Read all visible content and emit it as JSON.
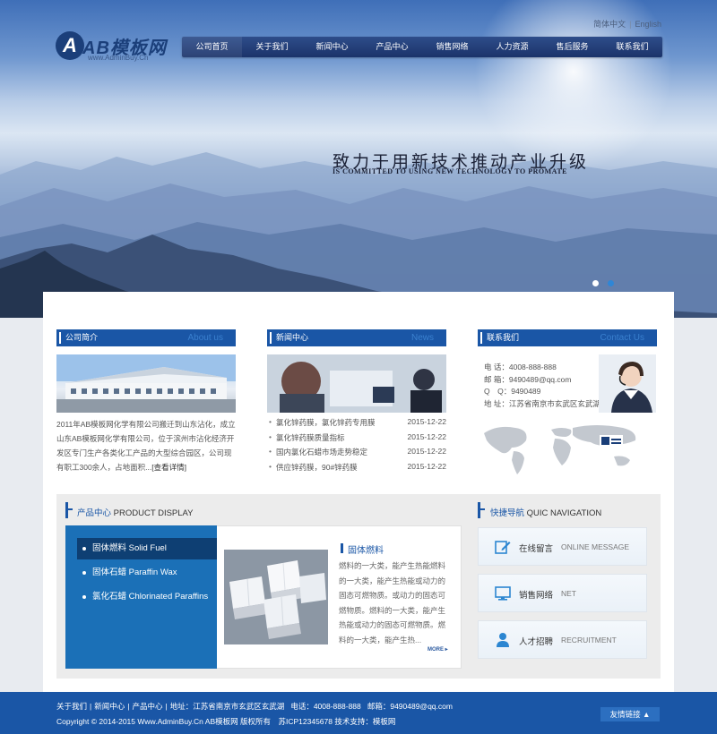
{
  "brand": {
    "logo_text": "AB模板网",
    "logo_mark": "A",
    "logo_sub": "www.AdminBuy.Cn"
  },
  "lang": [
    "简体中文",
    "English"
  ],
  "nav": [
    "公司首页",
    "关于我们",
    "新闻中心",
    "产品中心",
    "销售网络",
    "人力资源",
    "售后服务",
    "联系我们"
  ],
  "hero": {
    "slogan_cn": "致力于用新技术推动产业升级",
    "slogan_en": "IS COMMITTED TO USING NEW TECHNOLOGY TO PROMATE"
  },
  "about": {
    "title": "公司简介",
    "title_en": "About us",
    "text": "2011年AB模板网化学有限公司搬迁到山东沾化，成立山东AB模板网化学有限公司，位于滨州市沾化经济开发区专门生产各类化工产品的大型综合园区，公司现有职工300余人，占地面积...",
    "more": "[查看详情]"
  },
  "news": {
    "title": "新闻中心",
    "title_en": "News",
    "items": [
      {
        "title": "氯化锌药膜，氯化锌药专用膜",
        "date": "2015-12-22"
      },
      {
        "title": "氯化锌药膜质量指标",
        "date": "2015-12-22"
      },
      {
        "title": "国内氯化石蜡市场走势稳定",
        "date": "2015-12-22"
      },
      {
        "title": "供应锌药膜，90#锌药膜",
        "date": "2015-12-22"
      }
    ]
  },
  "contact": {
    "title": "联系我们",
    "title_en": "Contact Us",
    "lines": [
      "电 话：4008-888-888",
      "邮 箱：9490489@qq.com",
      "Q　Q：9490489",
      "地 址：江苏省南京市玄武区玄武湖"
    ]
  },
  "products": {
    "title": "产品中心",
    "title_en": "PRODUCT DISPLAY",
    "menu": [
      "固体燃料 Solid Fuel",
      "固体石蜡 Paraffin Wax",
      "氯化石蜡 Chlorinated Paraffins"
    ],
    "active_index": 0,
    "feature_title": "固体燃料",
    "feature_desc": "燃料的一大类，能产生热能燃料的一大类，能产生热能或动力的固态可燃物质。或动力的固态可燃物质。燃料的一大类，能产生热能或动力的固态可燃物质。燃料的一大类，能产生热...",
    "more": "MORE"
  },
  "quick_nav": {
    "title": "快捷导航",
    "title_en": "QUIC NAVIGATION",
    "items": [
      {
        "cn": "在线留言",
        "en": "ONLINE MESSAGE",
        "icon": "edit-icon"
      },
      {
        "cn": "销售网络",
        "en": "NET",
        "icon": "monitor-icon"
      },
      {
        "cn": "人才招聘",
        "en": "RECRUITMENT",
        "icon": "person-icon"
      }
    ]
  },
  "footer": {
    "links": [
      "关于我们",
      "新闻中心",
      "产品中心"
    ],
    "address": "地址：江苏省南京市玄武区玄武湖",
    "phone": "电话：4008-888-888",
    "email": "邮箱：9490489@qq.com",
    "copyright": "Copyright © 2014-2015 Www.AdminBuy.Cn AB模板网 版权所有　苏ICP12345678 技术支持：模板网",
    "friend_links": "友情链接 ▲"
  },
  "colors": {
    "primary": "#1a56a6",
    "nav_dark": "#1b336a",
    "menu_blue": "#1b70b7",
    "active_dark": "#0e3f73"
  }
}
